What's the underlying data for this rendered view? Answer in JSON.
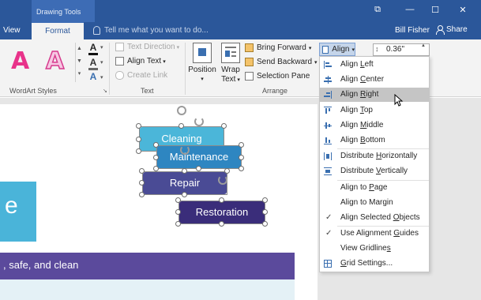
{
  "colors": {
    "accent": "#2b579a",
    "wordart_pink": "#e8338a",
    "shape_light_blue": "#4bb6d9",
    "shape_mid_blue": "#2e86c1",
    "shape_slate": "#4a4b95",
    "shape_indigo": "#3a2d7a",
    "slide_bar": "#5b4a9c",
    "menu_highlight": "#c5c5c5"
  },
  "window": {
    "context_group": "Drawing Tools",
    "controls": [
      "⧉",
      "—",
      "☐",
      "✕"
    ]
  },
  "tabs": {
    "view": "View",
    "format": "Format",
    "tell_me": "Tell me what you want to do...",
    "user": "Bill Fisher",
    "share": "Share"
  },
  "ribbon": {
    "wordart": {
      "label": "WordArt Styles",
      "sample": "A",
      "fill_icon": "A",
      "outline_icon": "A",
      "effects_icon": "A"
    },
    "text": {
      "label": "Text",
      "text_direction": "Text Direction",
      "align_text": "Align Text",
      "create_link": "Create Link"
    },
    "arrange": {
      "label": "Arrange",
      "position": "Position",
      "wrap_text_line1": "Wrap",
      "wrap_text_line2": "Text",
      "bring_forward": "Bring Forward",
      "send_backward": "Send Backward",
      "selection_pane": "Selection Pane",
      "align": "Align"
    },
    "size": {
      "height_value": "0.36\""
    }
  },
  "slide": {
    "letter": "e",
    "bar_text": ", safe, and clean",
    "shapes": {
      "cleaning": "Cleaning",
      "maintenance": "Maintenance",
      "repair": "Repair",
      "restoration": "Restoration"
    }
  },
  "align_menu": {
    "items": [
      {
        "label_pre": "Align ",
        "hot": "L",
        "label_post": "eft",
        "icon": "align-left-icon"
      },
      {
        "label_pre": "Align ",
        "hot": "C",
        "label_post": "enter",
        "icon": "align-center-icon"
      },
      {
        "label_pre": "Align ",
        "hot": "R",
        "label_post": "ight",
        "icon": "align-right-icon",
        "highlighted": true
      },
      {
        "label_pre": "Align ",
        "hot": "T",
        "label_post": "op",
        "icon": "align-top-icon"
      },
      {
        "label_pre": "Align ",
        "hot": "M",
        "label_post": "iddle",
        "icon": "align-middle-icon"
      },
      {
        "label_pre": "Align ",
        "hot": "B",
        "label_post": "ottom",
        "icon": "align-bottom-icon"
      },
      {
        "label_pre": "Distribute ",
        "hot": "H",
        "label_post": "orizontally",
        "icon": "distribute-horizontally-icon"
      },
      {
        "label_pre": "Distribute ",
        "hot": "V",
        "label_post": "ertically",
        "icon": "distribute-vertically-icon"
      },
      {
        "label_pre": "Align to ",
        "hot": "P",
        "label_post": "age",
        "icon": ""
      },
      {
        "label_pre": "Align to Margin",
        "hot": "",
        "label_post": "",
        "icon": ""
      },
      {
        "label_pre": "Align Selected ",
        "hot": "O",
        "label_post": "bjects",
        "icon": "checkmark-icon",
        "checked": true
      },
      {
        "label_pre": "Use Alignment ",
        "hot": "G",
        "label_post": "uides",
        "icon": "checkmark-icon",
        "checked": true
      },
      {
        "label_pre": "View Gridline",
        "hot": "s",
        "label_post": "",
        "icon": ""
      },
      {
        "label_pre": "",
        "hot": "G",
        "label_post": "rid Settings...",
        "icon": "grid-icon"
      }
    ]
  }
}
